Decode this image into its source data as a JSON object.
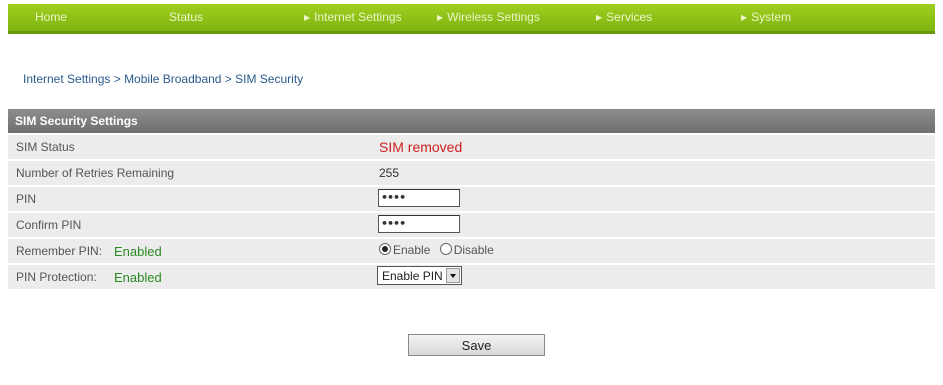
{
  "nav": {
    "home": "Home",
    "status": "Status",
    "internet_settings": "Internet Settings",
    "wireless_settings": "Wireless Settings",
    "services": "Services",
    "system": "System",
    "arrow_icon": "▶"
  },
  "breadcrumb": "Internet Settings > Mobile Broadband > SIM Security",
  "panel": {
    "title": "SIM Security Settings",
    "rows": {
      "sim_status_label": "SIM Status",
      "sim_status_value": "SIM removed",
      "retries_label": "Number of Retries Remaining",
      "retries_value": "255",
      "pin_label": "PIN",
      "pin_value": "••••",
      "confirm_pin_label": "Confirm PIN",
      "confirm_pin_value": "••••",
      "remember_pin_label": "Remember PIN:",
      "remember_pin_state": "Enabled",
      "remember_enable": "Enable",
      "remember_disable": "Disable",
      "pin_protection_label": "PIN Protection:",
      "pin_protection_state": "Enabled",
      "pin_protection_select": "Enable PIN"
    }
  },
  "save_label": "Save",
  "colors": {
    "nav_green": "#8cc21a",
    "header_gray": "#7a7a7a",
    "status_red": "#d01f1f",
    "enabled_green": "#2a8a22"
  }
}
